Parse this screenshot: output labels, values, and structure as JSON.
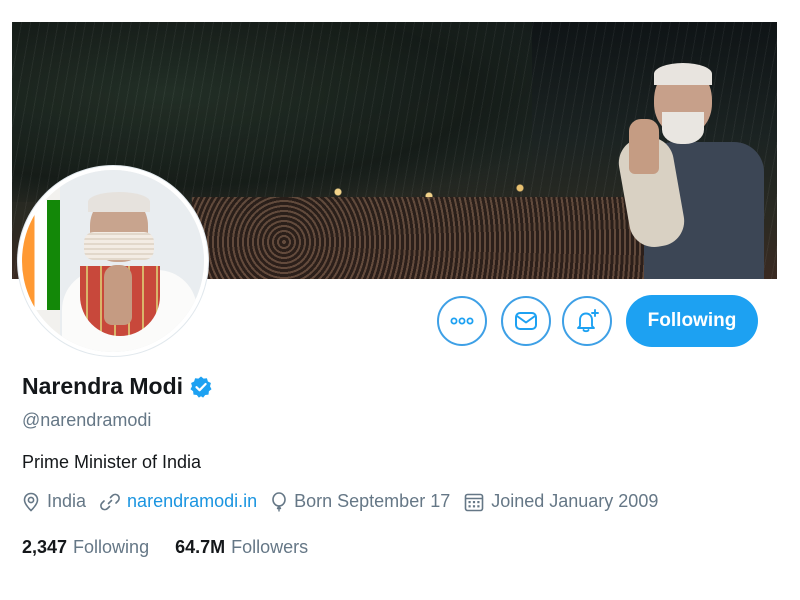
{
  "profile": {
    "display_name": "Narendra Modi",
    "verified": true,
    "handle": "@narendramodi",
    "bio": "Prime Minister of India",
    "location": "India",
    "website": "narendramodi.in",
    "birthday": "Born September 17",
    "joined": "Joined January 2009"
  },
  "actions": {
    "more_icon": "more-icon",
    "message_icon": "envelope-icon",
    "notify_icon": "bell-plus-icon",
    "follow_label": "Following"
  },
  "stats": {
    "following_count": "2,347",
    "following_label": "Following",
    "followers_count": "64.7M",
    "followers_label": "Followers"
  },
  "colors": {
    "accent": "#1da1f2",
    "link": "#1b95e0",
    "muted_text": "#657786",
    "primary_text": "#14171a",
    "button_border": "#3ea0e6"
  }
}
